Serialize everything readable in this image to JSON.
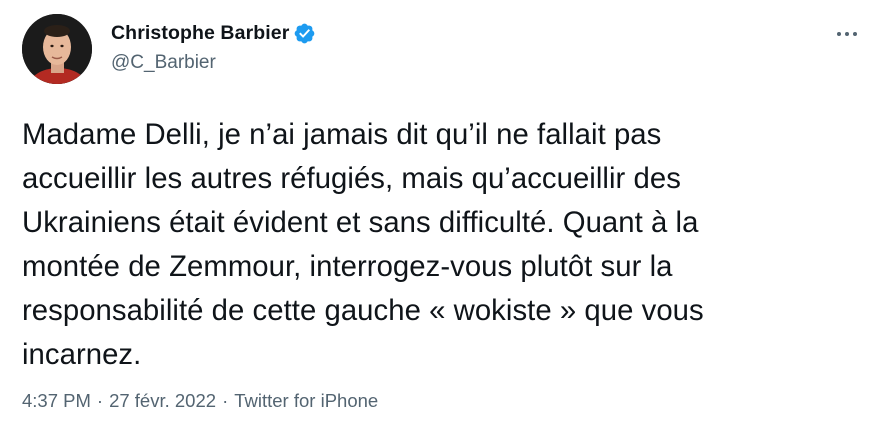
{
  "author": {
    "name": "Christophe Barbier",
    "handle": "@C_Barbier",
    "verified": true,
    "avatar_icon": "profile-photo"
  },
  "tweet": {
    "text": "Madame Delli, je n’ai jamais dit qu’il ne fallait pas\naccueillir les autres réfugiés, mais qu’accueillir des\nUkrainiens était évident et sans difficulté. Quant à la\nmontée de Zemmour, interrogez-vous plutôt sur la\nresponsabilité de cette gauche « wokiste » que vous\nincarnez."
  },
  "meta": {
    "time": "4:37 PM",
    "separator": "·",
    "date": "27 févr. 2022",
    "source": "Twitter for iPhone"
  },
  "menu": {
    "icon": "more-horizontal-icon"
  },
  "colors": {
    "text": "#0f1419",
    "secondary": "#536471",
    "verified_blue": "#1d9bf0"
  }
}
